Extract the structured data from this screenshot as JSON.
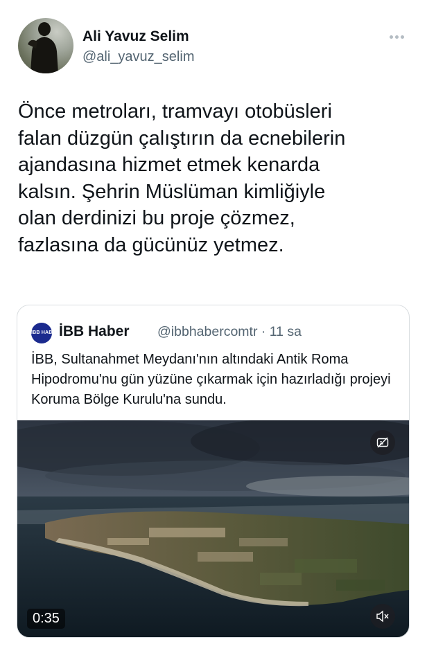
{
  "author": {
    "name": "Ali Yavuz Selim",
    "handle": "@ali_yavuz_selim"
  },
  "tweet": {
    "text": "Önce metroları, tramvayı otobüsleri\nfalan düzgün çalıştırın da ecnebilerin\najandasına hizmet etmek kenarda\nkalsın. Şehrin Müslüman kimliğiyle\nolan derdinizi bu proje çözmez,\nfazlasına da gücünüz yetmez."
  },
  "quoted": {
    "logo_text": "İBB HABER",
    "name": "İBB Haber",
    "meta": "@ibbhabercomtr · 11 sa",
    "text": "İBB, Sultanahmet Meydanı'nın altındaki Antik Roma Hipodromu'nu gün yüzüne çıkarmak için hazırladığı projeyi Koruma Bölge Kurulu'na sundu.",
    "video": {
      "duration": "0:35",
      "caption_icon": "closed-captions-off-icon",
      "mute_icon": "speaker-muted-icon"
    }
  },
  "colors": {
    "text": "#0f1419",
    "secondary": "#536471",
    "border": "#d9dde0",
    "logo_bg": "#1b2a8e"
  }
}
